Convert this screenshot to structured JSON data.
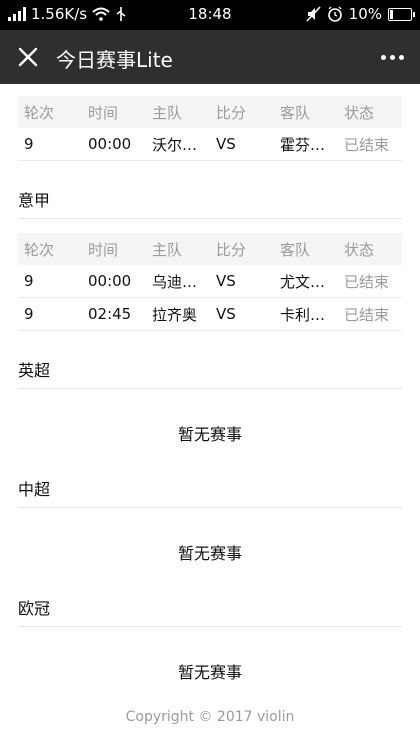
{
  "status_bar": {
    "speed": "1.56K/s",
    "time": "18:48",
    "battery": "10%",
    "icons": [
      "signal-icon",
      "wifi-icon",
      "usb-icon",
      "mute-icon",
      "alarm-icon",
      "battery-icon"
    ]
  },
  "navbar": {
    "title": "今日赛事Lite",
    "close_icon": "close-icon",
    "more_icon": "more-icon"
  },
  "table_headers": [
    "轮次",
    "时间",
    "主队",
    "比分",
    "客队",
    "状态"
  ],
  "sections": [
    {
      "league": "",
      "matches": [
        {
          "round": "9",
          "time": "00:00",
          "home": "沃尔…",
          "score": "VS",
          "away": "霍芬…",
          "status": "已结束"
        }
      ]
    },
    {
      "league": "意甲",
      "matches": [
        {
          "round": "9",
          "time": "00:00",
          "home": "乌迪…",
          "score": "VS",
          "away": "尤文…",
          "status": "已结束"
        },
        {
          "round": "9",
          "time": "02:45",
          "home": "拉齐奥",
          "score": "VS",
          "away": "卡利…",
          "status": "已结束"
        }
      ]
    },
    {
      "league": "英超",
      "empty": "暂无赛事"
    },
    {
      "league": "中超",
      "empty": "暂无赛事"
    },
    {
      "league": "欧冠",
      "empty": "暂无赛事"
    }
  ],
  "footer": {
    "copyright": "Copyright © 2017 violin"
  }
}
